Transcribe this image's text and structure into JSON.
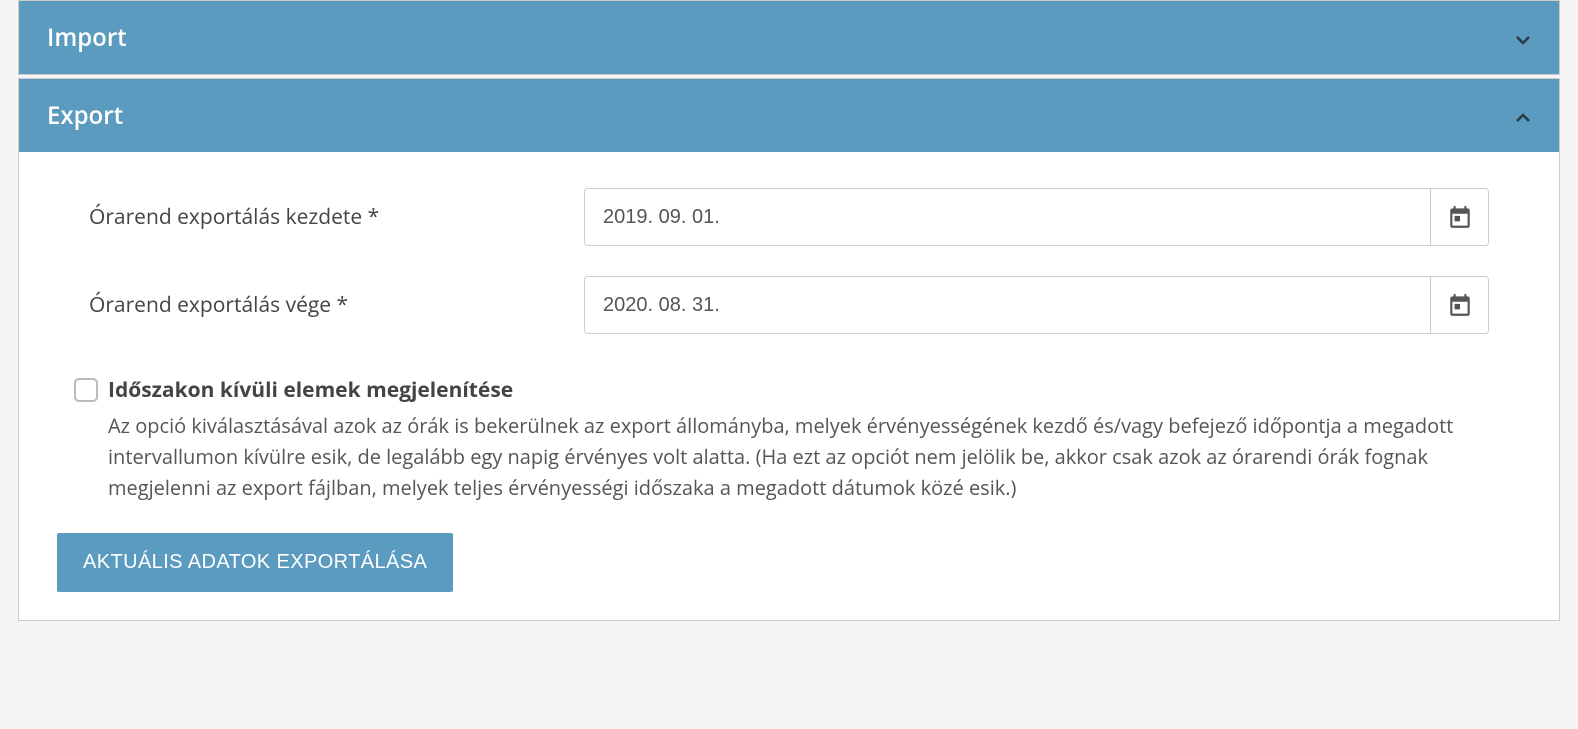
{
  "panels": {
    "import": {
      "title": "Import"
    },
    "export": {
      "title": "Export",
      "fields": {
        "start_date": {
          "label": "Órarend exportálás kezdete *",
          "value": "2019. 09. 01."
        },
        "end_date": {
          "label": "Órarend exportálás vége *",
          "value": "2020. 08. 31."
        }
      },
      "checkbox": {
        "title": "Időszakon kívüli elemek megjelenítése",
        "description": "Az opció kiválasztásával azok az órák is bekerülnek az export állományba, melyek érvényességének kezdő és/vagy befejező időpontja a megadott intervallumon kívülre esik, de legalább egy napig érvényes volt alatta. (Ha ezt az opciót nem jelölik be, akkor csak azok az órarendi órák fognak megjelenni az export fájlban, melyek teljes érvényességi időszaka a megadott dátumok közé esik.)"
      },
      "button_label": "AKTUÁLIS ADATOK EXPORTÁLÁSA"
    }
  }
}
